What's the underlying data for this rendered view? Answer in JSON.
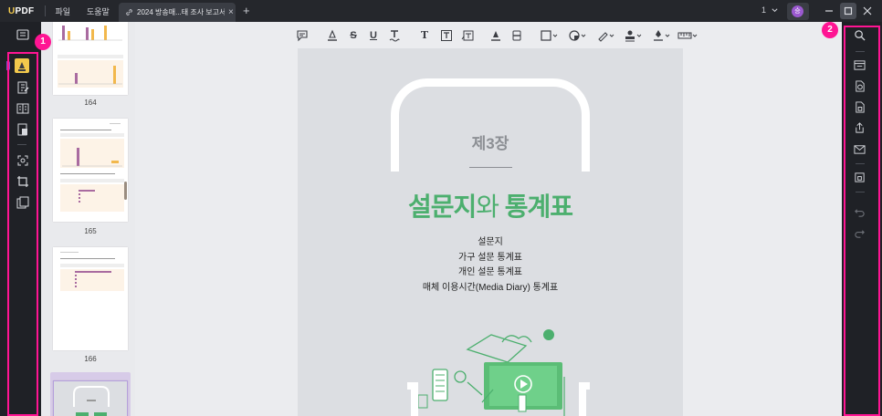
{
  "titlebar": {
    "logo_u": "U",
    "logo_rest": "PDF",
    "menu_file": "파일",
    "menu_help": "도움말",
    "tab_label": "2024 방송매...태 조사 보고서",
    "tab_close": "×",
    "new_tab": "+",
    "page_indicator": "1",
    "avatar_initial": "승"
  },
  "annotations": {
    "badge_left": "1",
    "badge_right": "2",
    "highlight_color": "#ff1493"
  },
  "thumbnails": {
    "pages": [
      "164",
      "165",
      "166"
    ]
  },
  "document": {
    "chapter": "제3장",
    "title_part1": "설문지",
    "title_part2": "와",
    "title_part3": "통계표",
    "toc": [
      "설문지",
      "가구 설문 통계표",
      "개인 설문 통계표",
      "매체 이용시간(Media Diary) 통계표"
    ],
    "accent_color": "#4caf6e"
  },
  "toolbar": {
    "underline_label": "U",
    "text_label": "T",
    "strikethrough_label": "S"
  }
}
